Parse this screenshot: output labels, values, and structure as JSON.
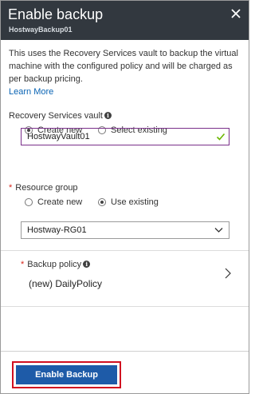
{
  "header": {
    "title": "Enable backup",
    "subtitle": "HostwayBackup01",
    "close_icon": "close-icon"
  },
  "intro": {
    "text": "This uses the Recovery Services vault to backup the virtual machine with the configured policy and will be charged as per backup pricing.",
    "link": "Learn More"
  },
  "vault": {
    "label": "Recovery Services vault",
    "option_create": "Create new",
    "option_existing": "Select existing",
    "selected": "Create new",
    "input_value": "HostwayVault01",
    "valid_color": "#6bb700"
  },
  "resource_group": {
    "required_marker": "*",
    "label": "Resource group",
    "option_create": "Create new",
    "option_existing": "Use existing",
    "selected": "Use existing",
    "dropdown_value": "Hostway-RG01"
  },
  "policy": {
    "required_marker": "*",
    "label": "Backup policy",
    "value": "(new) DailyPolicy"
  },
  "footer": {
    "enable_button": "Enable Backup",
    "button_color": "#1e5ba8",
    "highlight_color": "#d10f20"
  }
}
